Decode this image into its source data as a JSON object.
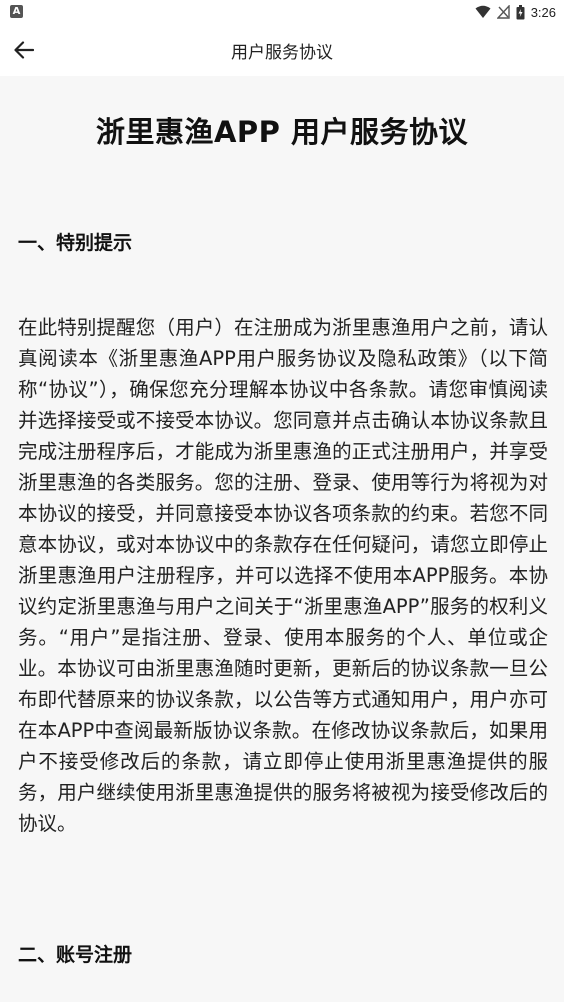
{
  "status_bar": {
    "left_badge": "A",
    "time": "3:26",
    "icons": [
      "wifi-icon",
      "signal-icon",
      "battery-icon"
    ]
  },
  "app_bar": {
    "title": "用户服务协议",
    "back_icon": "arrow-left-icon"
  },
  "document": {
    "title": "浙里惠渔APP 用户服务协议",
    "sections": [
      {
        "heading": "一、特别提示",
        "body": "在此特别提醒您（用户）在注册成为浙里惠渔用户之前，请认真阅读本《浙里惠渔APP用户服务协议及隐私政策》（以下简称“协议”），确保您充分理解本协议中各条款。请您审慎阅读并选择接受或不接受本协议。您同意并点击确认本协议条款且完成注册程序后，才能成为浙里惠渔的正式注册用户，并享受浙里惠渔的各类服务。您的注册、登录、使用等行为将视为对本协议的接受，并同意接受本协议各项条款的约束。若您不同意本协议，或对本协议中的条款存在任何疑问，请您立即停止浙里惠渔用户注册程序，并可以选择不使用本APP服务。本协议约定浙里惠渔与用户之间关于“浙里惠渔APP”服务的权利义务。“用户”是指注册、登录、使用本服务的个人、单位或企业。本协议可由浙里惠渔随时更新，更新后的协议条款一旦公布即代替原来的协议条款，以公告等方式通知用户，用户亦可在本APP中查阅最新版协议条款。在修改协议条款后，如果用户不接受修改后的条款，请立即停止使用浙里惠渔提供的服务，用户继续使用浙里惠渔提供的服务将被视为接受修改后的协议。"
      },
      {
        "heading": "二、账号注册"
      }
    ]
  },
  "colors": {
    "content_background": "#f7f7f7",
    "text_primary": "#111111"
  }
}
